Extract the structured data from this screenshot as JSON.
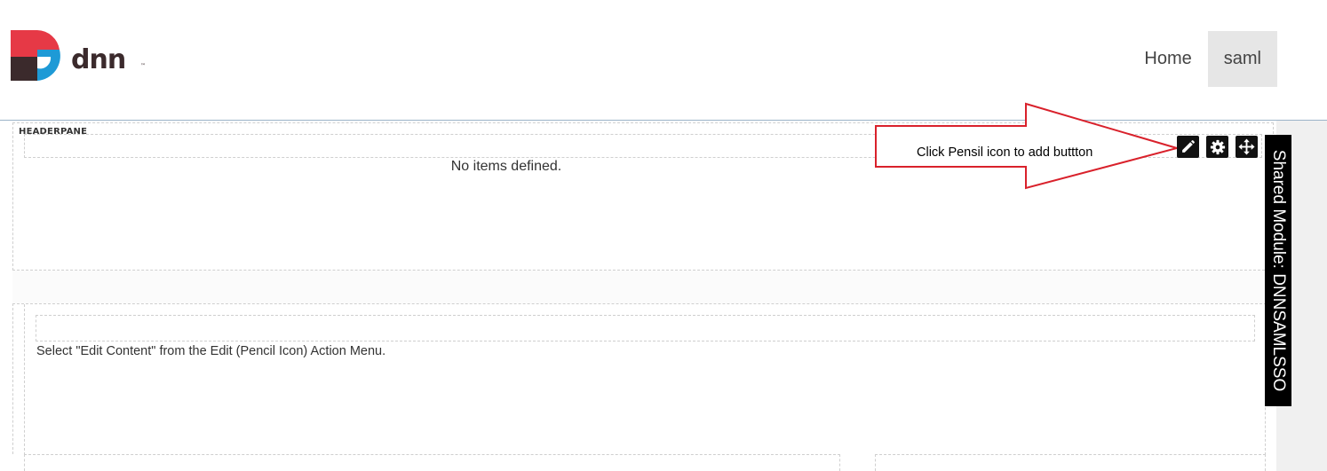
{
  "header": {
    "logo_text": "dnn",
    "nav": [
      {
        "label": "Home",
        "active": false
      },
      {
        "label": "saml",
        "active": true
      }
    ]
  },
  "headerpane": {
    "label": "HEADERPANE",
    "empty_message": "No items defined."
  },
  "contentpane": {
    "hint": "Select \"Edit Content\" from the Edit (Pencil Icon) Action Menu."
  },
  "module": {
    "shared_label": "Shared Module: DNNSAMLSSO",
    "actions": [
      "pencil-icon",
      "gear-icon",
      "move-icon"
    ]
  },
  "annotation": {
    "text": "Click Pensil icon to add buttton",
    "color": "#d9212b"
  },
  "colors": {
    "logo_red": "#e63946",
    "logo_blue": "#1e9ad6",
    "logo_dark": "#3b2a2c",
    "nav_active_bg": "#e6e6e6"
  }
}
